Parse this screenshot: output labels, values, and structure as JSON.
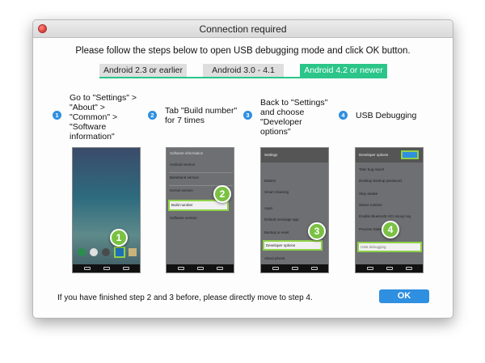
{
  "window": {
    "title": "Connection required"
  },
  "instruction": "Please follow the steps below to open USB debugging mode and click OK button.",
  "tabs": [
    {
      "label": "Android 2.3 or earlier"
    },
    {
      "label": "Android 3.0 - 4.1"
    },
    {
      "label": "Android 4.2 or newer"
    }
  ],
  "steps": [
    {
      "number": "1",
      "text": "Go to \"Settings\" > \"About\" > \"Common\" > \"Software information\""
    },
    {
      "number": "2",
      "text": "Tab \"Build number\" for 7 times"
    },
    {
      "number": "3",
      "text": "Back to \"Settings\" and choose \"Developer options\""
    },
    {
      "number": "4",
      "text": "USB Debugging"
    }
  ],
  "screens": {
    "s2": {
      "rows": [
        "Software information",
        "Android version",
        "Baseband version",
        "Kernel version",
        "Build number",
        "Software version"
      ],
      "badge": "2"
    },
    "s3": {
      "header": "Settings",
      "rows": [
        "Battery",
        "Smart cleaning",
        "Apps",
        "Default message app",
        "Backup & reset",
        "Developer options",
        "About phone"
      ],
      "badge": "3"
    },
    "s4": {
      "header": "Developer options",
      "rows": [
        "Take bug report",
        "Desktop backup password",
        "Stay awake",
        "Select runtime",
        "Enable Bluetooth HCI snoop log",
        "Process Stats",
        "USB debugging"
      ],
      "badge": "4"
    },
    "s1": {
      "badge": "1"
    }
  },
  "footer": {
    "text": "If you have finished step 2 and 3 before, please directly move to step 4."
  },
  "ok_button": {
    "label": "OK"
  },
  "colors": {
    "accent_green": "#2cc589",
    "step_blue": "#2f8fe0",
    "badge_green": "#7ac143"
  }
}
